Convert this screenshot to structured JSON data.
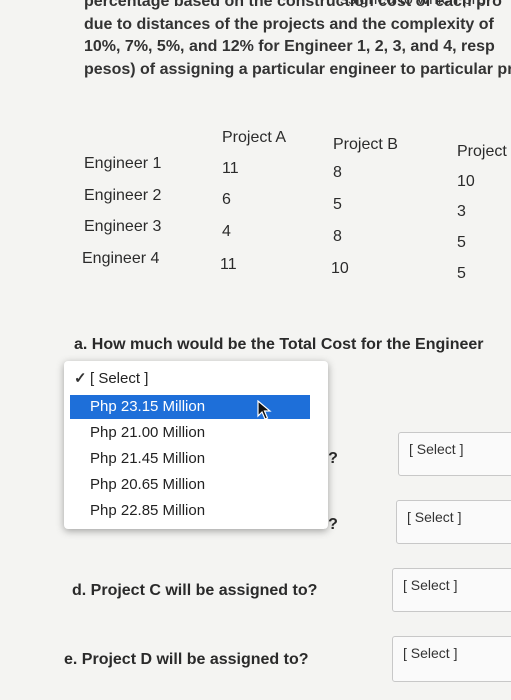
{
  "intro_lines": [
    "percentage based on the construction cost of each pro",
    "due to distances of the projects and the complexity of",
    "10%, 7%, 5%, and 12% for Engineer 1, 2, 3, and 4, resp",
    "pesos) of assigning a particular engineer to particular pr"
  ],
  "top_right_fragment": "ssigned to which pro",
  "table": {
    "headers": [
      "Project A",
      "Project B",
      "Project"
    ],
    "rows": [
      {
        "label": "Engineer 1",
        "values": [
          "11",
          "8",
          "10"
        ]
      },
      {
        "label": "Engineer 2",
        "values": [
          "6",
          "5",
          "3"
        ]
      },
      {
        "label": "Engineer 3",
        "values": [
          "4",
          "8",
          "5"
        ]
      },
      {
        "label": "Engineer 4",
        "values": [
          "11",
          "10",
          "5"
        ]
      }
    ]
  },
  "question_a": "a.  How much would be the Total Cost for the Engineer",
  "dropdown": {
    "placeholder": "[ Select ]",
    "options": [
      "Php 23.15 Million",
      "Php 21.00 Million",
      "Php 21.45 Million",
      "Php 20.65 Million",
      "Php 22.85 Million"
    ],
    "highlighted_index": 0
  },
  "question_b_tail": "to?",
  "question_c_tail": "to?",
  "question_d": "d.  Project C will be assigned to?",
  "question_e": "e.  Project D will be assigned to?",
  "select_b": "[ Select ]",
  "select_c": "[ Select ]",
  "select_d": "[ Select ]",
  "select_e": "[ Select ]",
  "colors": {
    "highlight": "#1e6fd9",
    "background": "#f4f4f2"
  }
}
